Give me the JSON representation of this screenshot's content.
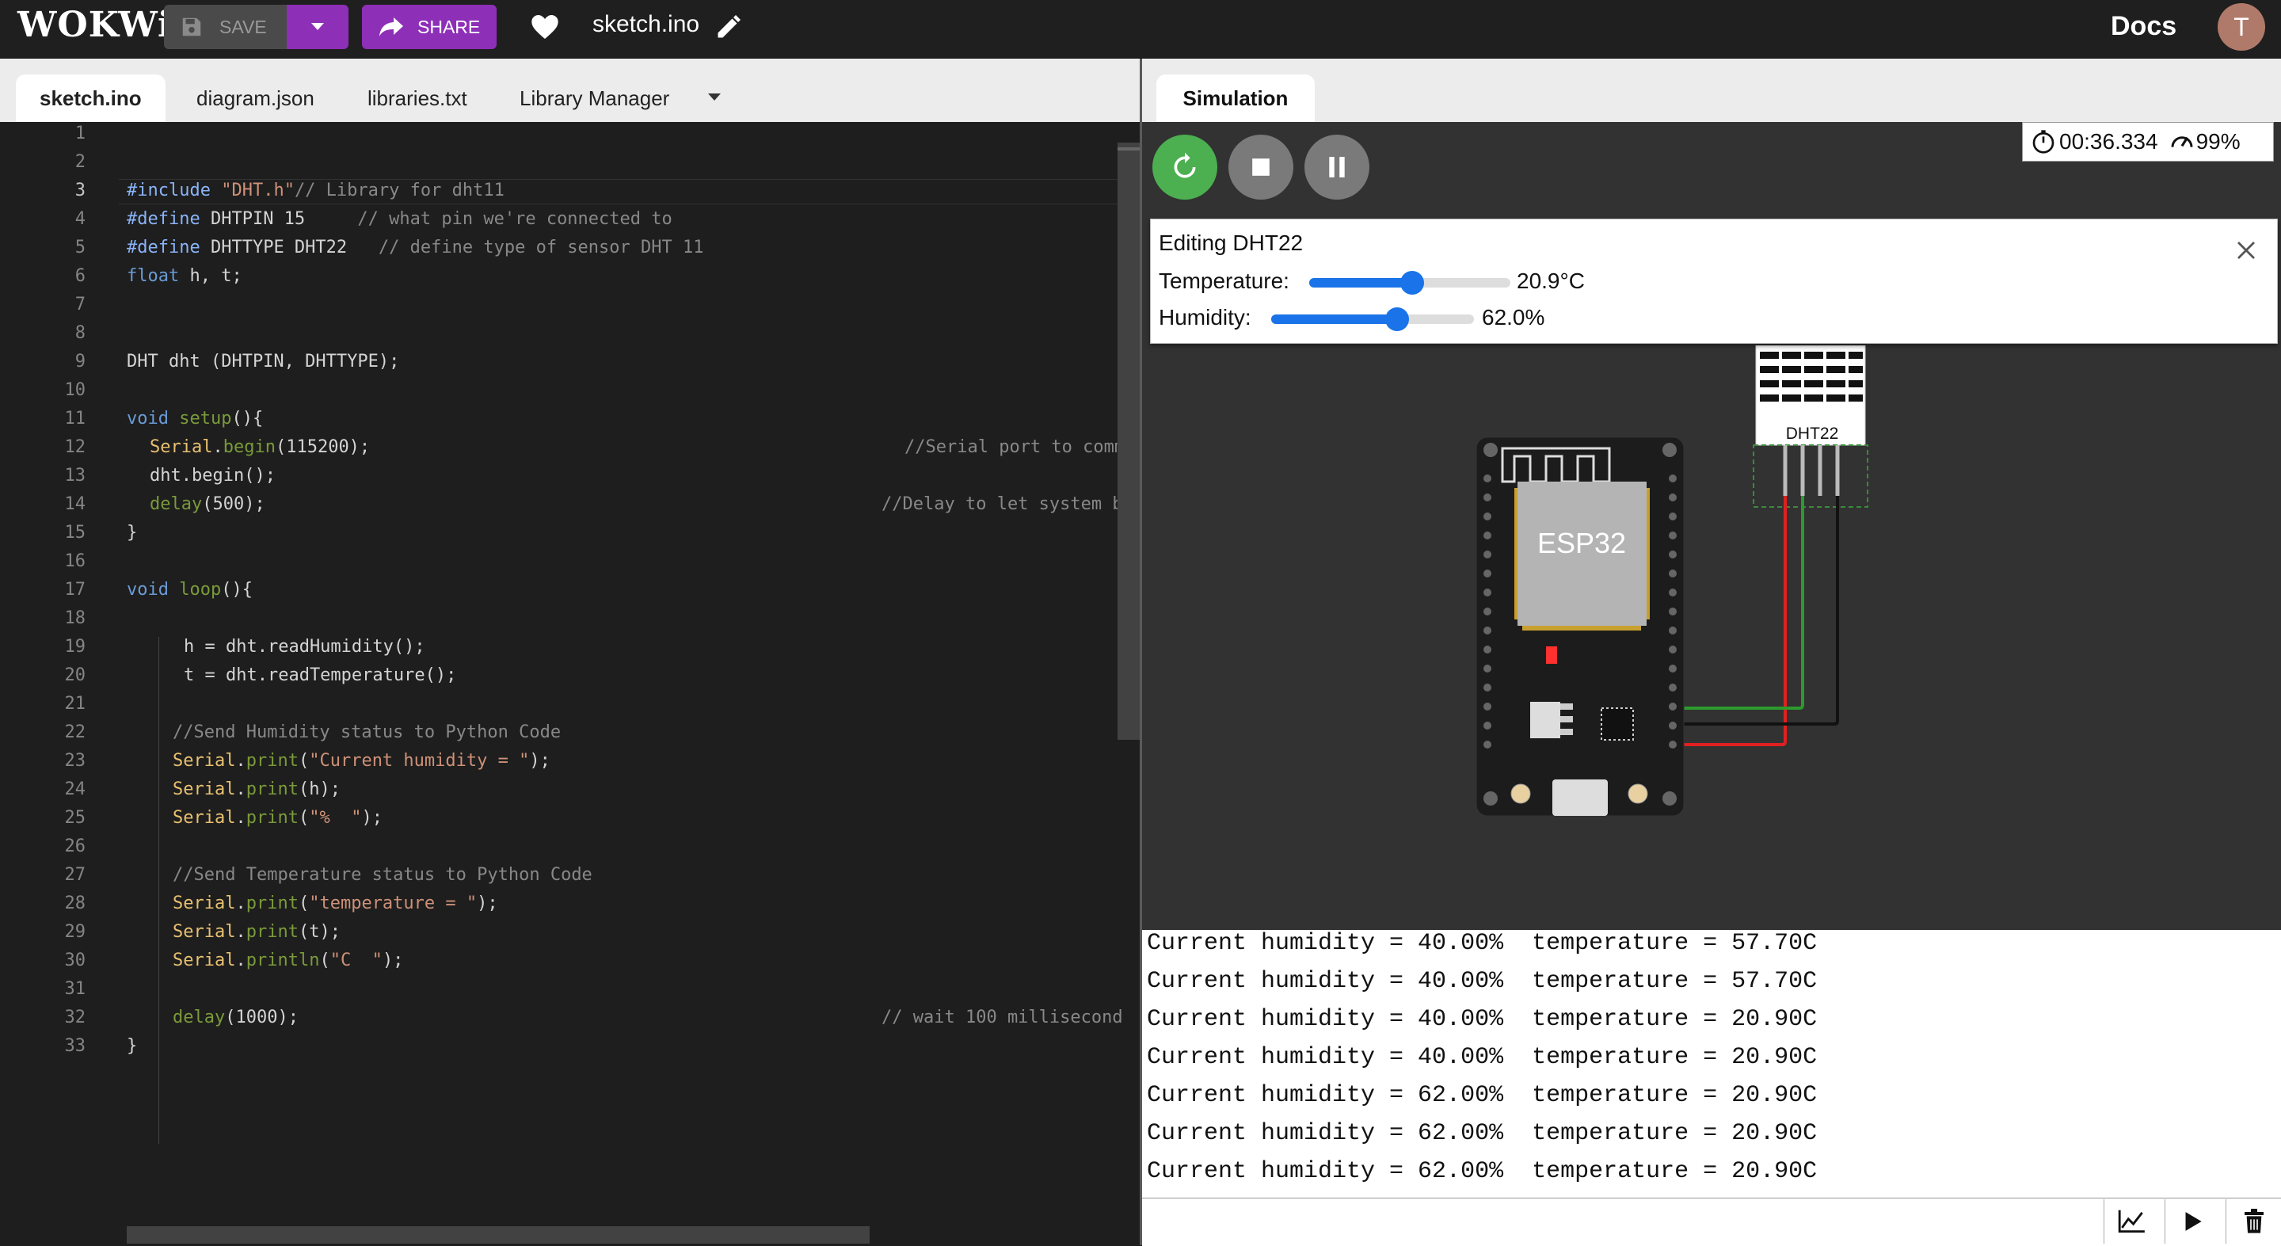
{
  "app": {
    "logo": "WOKWi"
  },
  "toolbar": {
    "save_label": "SAVE",
    "share_label": "SHARE",
    "filename": "sketch.ino",
    "docs_label": "Docs",
    "avatar_initial": "T"
  },
  "tabs": [
    {
      "label": "sketch.ino",
      "active": true
    },
    {
      "label": "diagram.json",
      "active": false
    },
    {
      "label": "libraries.txt",
      "active": false
    },
    {
      "label": "Library Manager",
      "active": false
    }
  ],
  "editor": {
    "line_numbers": [
      "1",
      "2",
      "3",
      "4",
      "5",
      "6",
      "7",
      "8",
      "9",
      "10",
      "11",
      "12",
      "13",
      "14",
      "15",
      "16",
      "17",
      "18",
      "19",
      "20",
      "21",
      "22",
      "23",
      "24",
      "25",
      "26",
      "27",
      "28",
      "29",
      "30",
      "31",
      "32",
      "33"
    ],
    "current_line": 3,
    "code": {
      "l3a": "#include ",
      "l3b": "\"DHT.h\"",
      "l3c": "// Library for dht11",
      "l4a": "#define ",
      "l4b": "DHTPIN 15     ",
      "l4c": "// what pin we're connected to",
      "l5a": "#define ",
      "l5b": "DHTTYPE DHT22   ",
      "l5c": "// define type of sensor DHT 11",
      "l6a": "float",
      "l6b": " h, t;",
      "l9": "DHT dht (DHTPIN, DHTTYPE);",
      "l11a": "void",
      "l11b": "setup",
      "l11c": "(){",
      "l12a": "Serial",
      "l12b": ".",
      "l12c": "begin",
      "l12d": "(115200);",
      "l12e": "//Serial port to comm",
      "l13": "dht.begin();",
      "l14a": "delay",
      "l14b": "(500);",
      "l14c": "//Delay to let system b",
      "l15": "}",
      "l17a": "void",
      "l17b": "loop",
      "l17c": "(){",
      "l19": "h = dht.readHumidity();",
      "l20": "t = dht.readTemperature();",
      "l22": "//Send Humidity status to Python Code",
      "l23a": "Serial",
      "l23b": ".",
      "l23c": "print",
      "l23d": "(",
      "l23e": "\"Current humidity = \"",
      "l23f": ");",
      "l24a": "Serial",
      "l24b": ".",
      "l24c": "print",
      "l24d": "(h);",
      "l25a": "Serial",
      "l25b": ".",
      "l25c": "print",
      "l25d": "(",
      "l25e": "\"%  \"",
      "l25f": ");",
      "l27": "//Send Temperature status to Python Code",
      "l28a": "Serial",
      "l28b": ".",
      "l28c": "print",
      "l28d": "(",
      "l28e": "\"temperature = \"",
      "l28f": ");",
      "l29a": "Serial",
      "l29b": ".",
      "l29c": "print",
      "l29d": "(t);",
      "l30a": "Serial",
      "l30b": ".",
      "l30c": "println",
      "l30d": "(",
      "l30e": "\"C  \"",
      "l30f": ");",
      "l32a": "delay",
      "l32b": "(1000);",
      "l32c": "// wait 100 millisecond",
      "l33": "}"
    }
  },
  "simulation": {
    "tab_label": "Simulation",
    "timer": "00:36.334",
    "speed": "99%",
    "edit_panel": {
      "title": "Editing DHT22",
      "temperature_label": "Temperature:",
      "temperature_value": "20.9°C",
      "temperature_fraction": 0.51,
      "humidity_label": "Humidity:",
      "humidity_value": "62.0%",
      "humidity_fraction": 0.62
    },
    "esp32_label": "ESP32",
    "dht22_label": "DHT22"
  },
  "serial": {
    "lines": [
      "Current humidity = 40.00%  temperature = 57.70C",
      "Current humidity = 40.00%  temperature = 57.70C",
      "Current humidity = 40.00%  temperature = 20.90C",
      "Current humidity = 40.00%  temperature = 20.90C",
      "Current humidity = 62.00%  temperature = 20.90C",
      "Current humidity = 62.00%  temperature = 20.90C",
      "Current humidity = 62.00%  temperature = 20.90C"
    ]
  },
  "colors": {
    "accent": "#8e2fb8",
    "play": "#4caf50",
    "slider": "#1a73e8"
  },
  "icons": [
    "save-icon",
    "chevron-down-icon",
    "share-icon",
    "heart-icon",
    "pencil-icon",
    "restart-icon",
    "stop-icon",
    "pause-icon",
    "stopwatch-icon",
    "speedometer-icon",
    "close-icon",
    "chart-icon",
    "play-icon",
    "trash-icon"
  ]
}
